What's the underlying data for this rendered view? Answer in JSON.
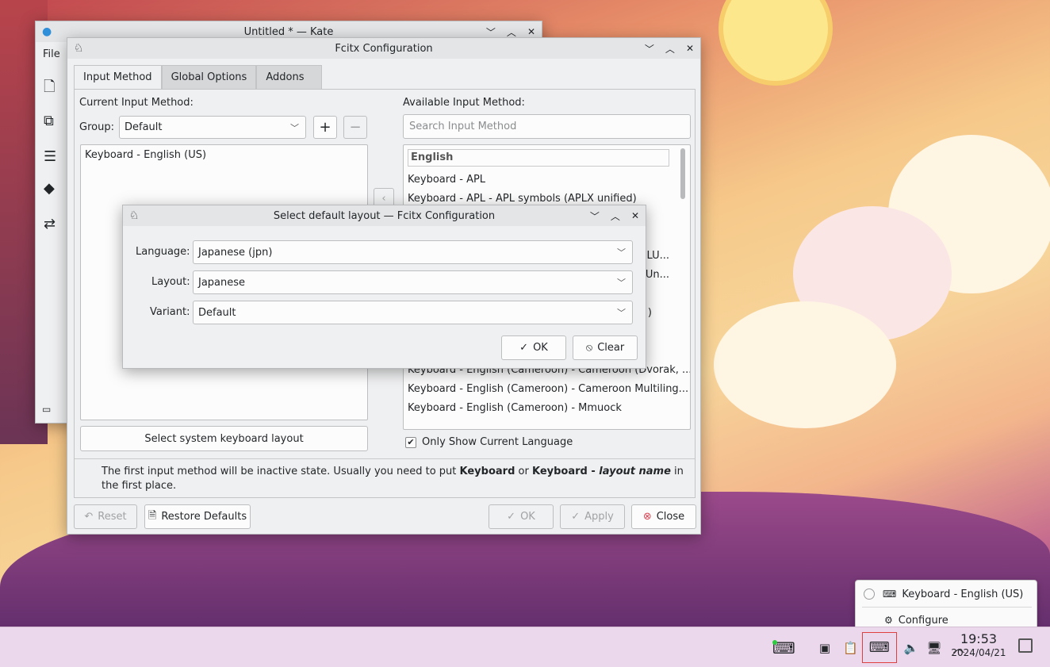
{
  "kate": {
    "title": "Untitled * — Kate",
    "menu_file": "File"
  },
  "fcitx": {
    "title": "Fcitx Configuration",
    "tabs": [
      {
        "label": "Input Method"
      },
      {
        "label": "Global Options"
      },
      {
        "label": "Addons"
      }
    ],
    "current_label": "Current Input Method:",
    "group_label": "Group:",
    "group_value": "Default",
    "current_items": [
      "Keyboard - English (US)"
    ],
    "select_system_button": "Select system keyboard layout",
    "available_label": "Available Input Method:",
    "search_placeholder": "Search Input Method",
    "available_header": "English",
    "available_items": [
      "Keyboard - APL",
      "Keyboard - APL - APL symbols (APLX unified)",
      "...LU...",
      "...Un...",
      ")",
      "Keyboard - English (Cameroon)",
      "Keyboard - English (Cameroon) - Cameroon (Dvorak, ...",
      "Keyboard - English (Cameroon) - Cameroon Multiling...",
      "Keyboard - English (Cameroon) - Mmuock"
    ],
    "only_current_language": "Only Show Current Language",
    "info_text_1": "The first input method will be inactive state. Usually you need to put ",
    "info_bold_1": "Keyboard",
    "info_text_2": " or ",
    "info_bold_2": "Keyboard - ",
    "info_bold_italic": "layout name",
    "info_text_3": " in the first place.",
    "buttons": {
      "reset": "Reset",
      "restore": "Restore Defaults",
      "ok": "OK",
      "apply": "Apply",
      "close": "Close"
    }
  },
  "layout_dialog": {
    "title": "Select default layout — Fcitx Configuration",
    "language_label": "Language:",
    "language_value": "Japanese (jpn)",
    "layout_label": "Layout:",
    "layout_value": "Japanese",
    "variant_label": "Variant:",
    "variant_value": "Default",
    "ok": "OK",
    "clear": "Clear"
  },
  "tray_popup": {
    "item1": "Keyboard - English (US)",
    "item2": "Configure"
  },
  "clock": {
    "time": "19:53",
    "date": "2024/04/21"
  },
  "colors": {
    "accent": "#3daee9",
    "close_red": "#da4453"
  }
}
